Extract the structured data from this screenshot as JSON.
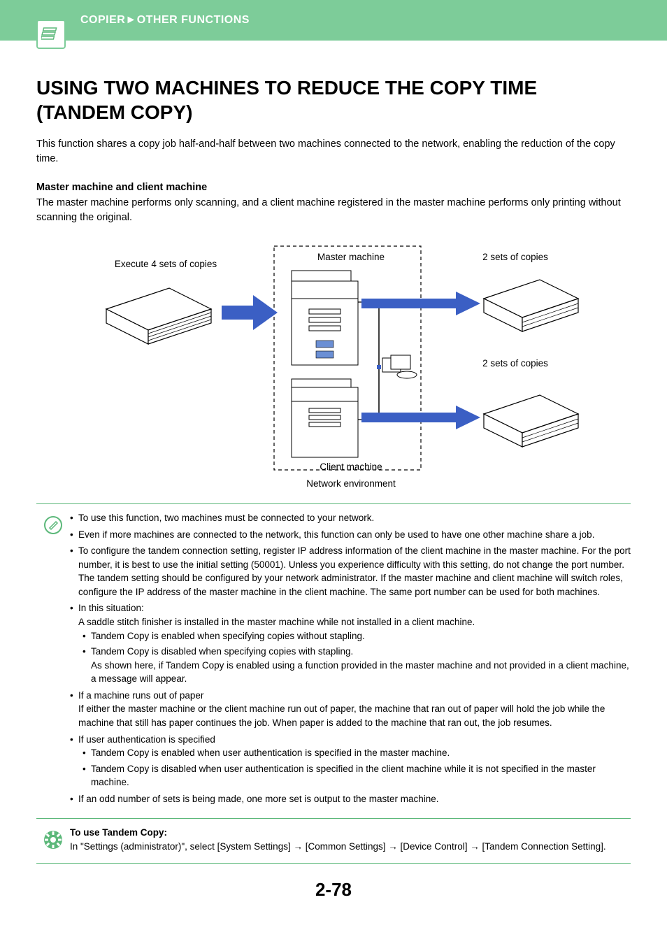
{
  "header": {
    "breadcrumb_left": "COPIER",
    "breadcrumb_sep": "►",
    "breadcrumb_right": "OTHER FUNCTIONS"
  },
  "title": "USING TWO MACHINES TO REDUCE THE COPY TIME (TANDEM COPY)",
  "intro": "This function shares a copy job half-and-half between two machines connected to the network, enabling the reduction of the copy time.",
  "subheading": "Master machine and client machine",
  "subtext": "The master machine performs only scanning, and a client machine registered in the master machine performs only printing without scanning the original.",
  "diagram": {
    "execute_label": "Execute 4 sets of copies",
    "master_label": "Master machine",
    "client_label": "Client machine",
    "network_label": "Network environment",
    "sets_a": "2 sets of copies",
    "sets_b": "2 sets of copies"
  },
  "notes": {
    "b1": "To use this function, two machines must be connected to your network.",
    "b2": "Even if more machines are connected to the network, this function can only be used to have one other machine share a job.",
    "b3": "To configure the tandem connection setting, register IP address information of the client machine in the master machine. For the port number, it is best to use the initial setting (50001). Unless you experience difficulty with this setting, do not change the port number. The tandem setting should be configured by your network administrator. If the master machine and client machine will switch roles, configure the IP address of the master machine in the client machine. The same port number can be used for both machines.",
    "b4_head": "In this situation:",
    "b4_line": "A saddle stitch finisher is installed in the master machine while not installed in a client machine.",
    "b4_s1": "Tandem Copy is enabled when specifying copies without stapling.",
    "b4_s2": "Tandem Copy is disabled when specifying copies with stapling.\nAs shown here, if Tandem Copy is enabled using a function provided in the master machine and not provided in a client machine, a message will appear.",
    "b5_head": "If a machine runs out of paper",
    "b5_body": "If either the master machine or the client machine run out of paper, the machine that ran out of paper will hold the job while the machine that still has paper continues the job. When paper is added to the machine that ran out, the job resumes.",
    "b6_head": "If user authentication is specified",
    "b6_s1": "Tandem Copy is enabled when user authentication is specified in the master machine.",
    "b6_s2": "Tandem Copy is disabled when user authentication is specified in the client machine while it is not specified in the master machine.",
    "b7": "If an odd number of sets is being made, one more set is output to the master machine."
  },
  "usage": {
    "heading": "To use Tandem Copy:",
    "body": "In \"Settings (administrator)\", select [System Settings] → [Common Settings] → [Device Control] → [Tandem Connection Setting]."
  },
  "page_number": "2-78"
}
